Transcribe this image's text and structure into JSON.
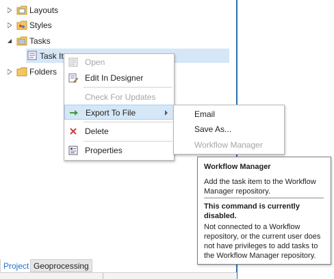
{
  "tree": {
    "items": [
      {
        "label": "Layouts",
        "expanded": false,
        "icon": "layouts-folder-icon"
      },
      {
        "label": "Styles",
        "expanded": false,
        "icon": "styles-folder-icon"
      },
      {
        "label": "Tasks",
        "expanded": true,
        "icon": "tasks-folder-icon"
      },
      {
        "label": "Task Ite",
        "selected": true,
        "icon": "task-item-icon"
      },
      {
        "label": "Folders",
        "expanded": false,
        "icon": "folder-icon"
      }
    ]
  },
  "context_menu": {
    "items": [
      {
        "label": "Open",
        "enabled": false,
        "icon": "open-icon"
      },
      {
        "label": "Edit In Designer",
        "enabled": true,
        "icon": "edit-designer-icon"
      },
      {
        "label": "Check For Updates",
        "enabled": false
      },
      {
        "label": "Export To File",
        "enabled": true,
        "highlighted": true,
        "has_submenu": true,
        "icon": "green-arrow-right-icon"
      },
      {
        "label": "Delete",
        "enabled": true,
        "icon": "red-x-icon"
      },
      {
        "label": "Properties",
        "enabled": true,
        "icon": "properties-icon"
      }
    ]
  },
  "submenu": {
    "items": [
      {
        "label": "Email",
        "enabled": true
      },
      {
        "label": "Save As...",
        "enabled": true
      },
      {
        "label": "Workflow Manager",
        "enabled": false
      }
    ]
  },
  "tooltip": {
    "title": "Workflow Manager",
    "description": "Add the task item to the Workflow Manager repository.",
    "disabled_title": "This command is currently disabled.",
    "disabled_description": "Not connected to a Workflow repository, or the current user does not have privileges to add tasks to the Workflow Manager repository."
  },
  "tabs": [
    {
      "label": "Project",
      "active": true
    },
    {
      "label": "Geoprocessing",
      "active": false
    }
  ],
  "colors": {
    "selection": "#d5e7f7",
    "accent_blue": "#2b6cb0",
    "tab_active_text": "#1a73c8",
    "disabled_text": "#a6a6a6"
  }
}
